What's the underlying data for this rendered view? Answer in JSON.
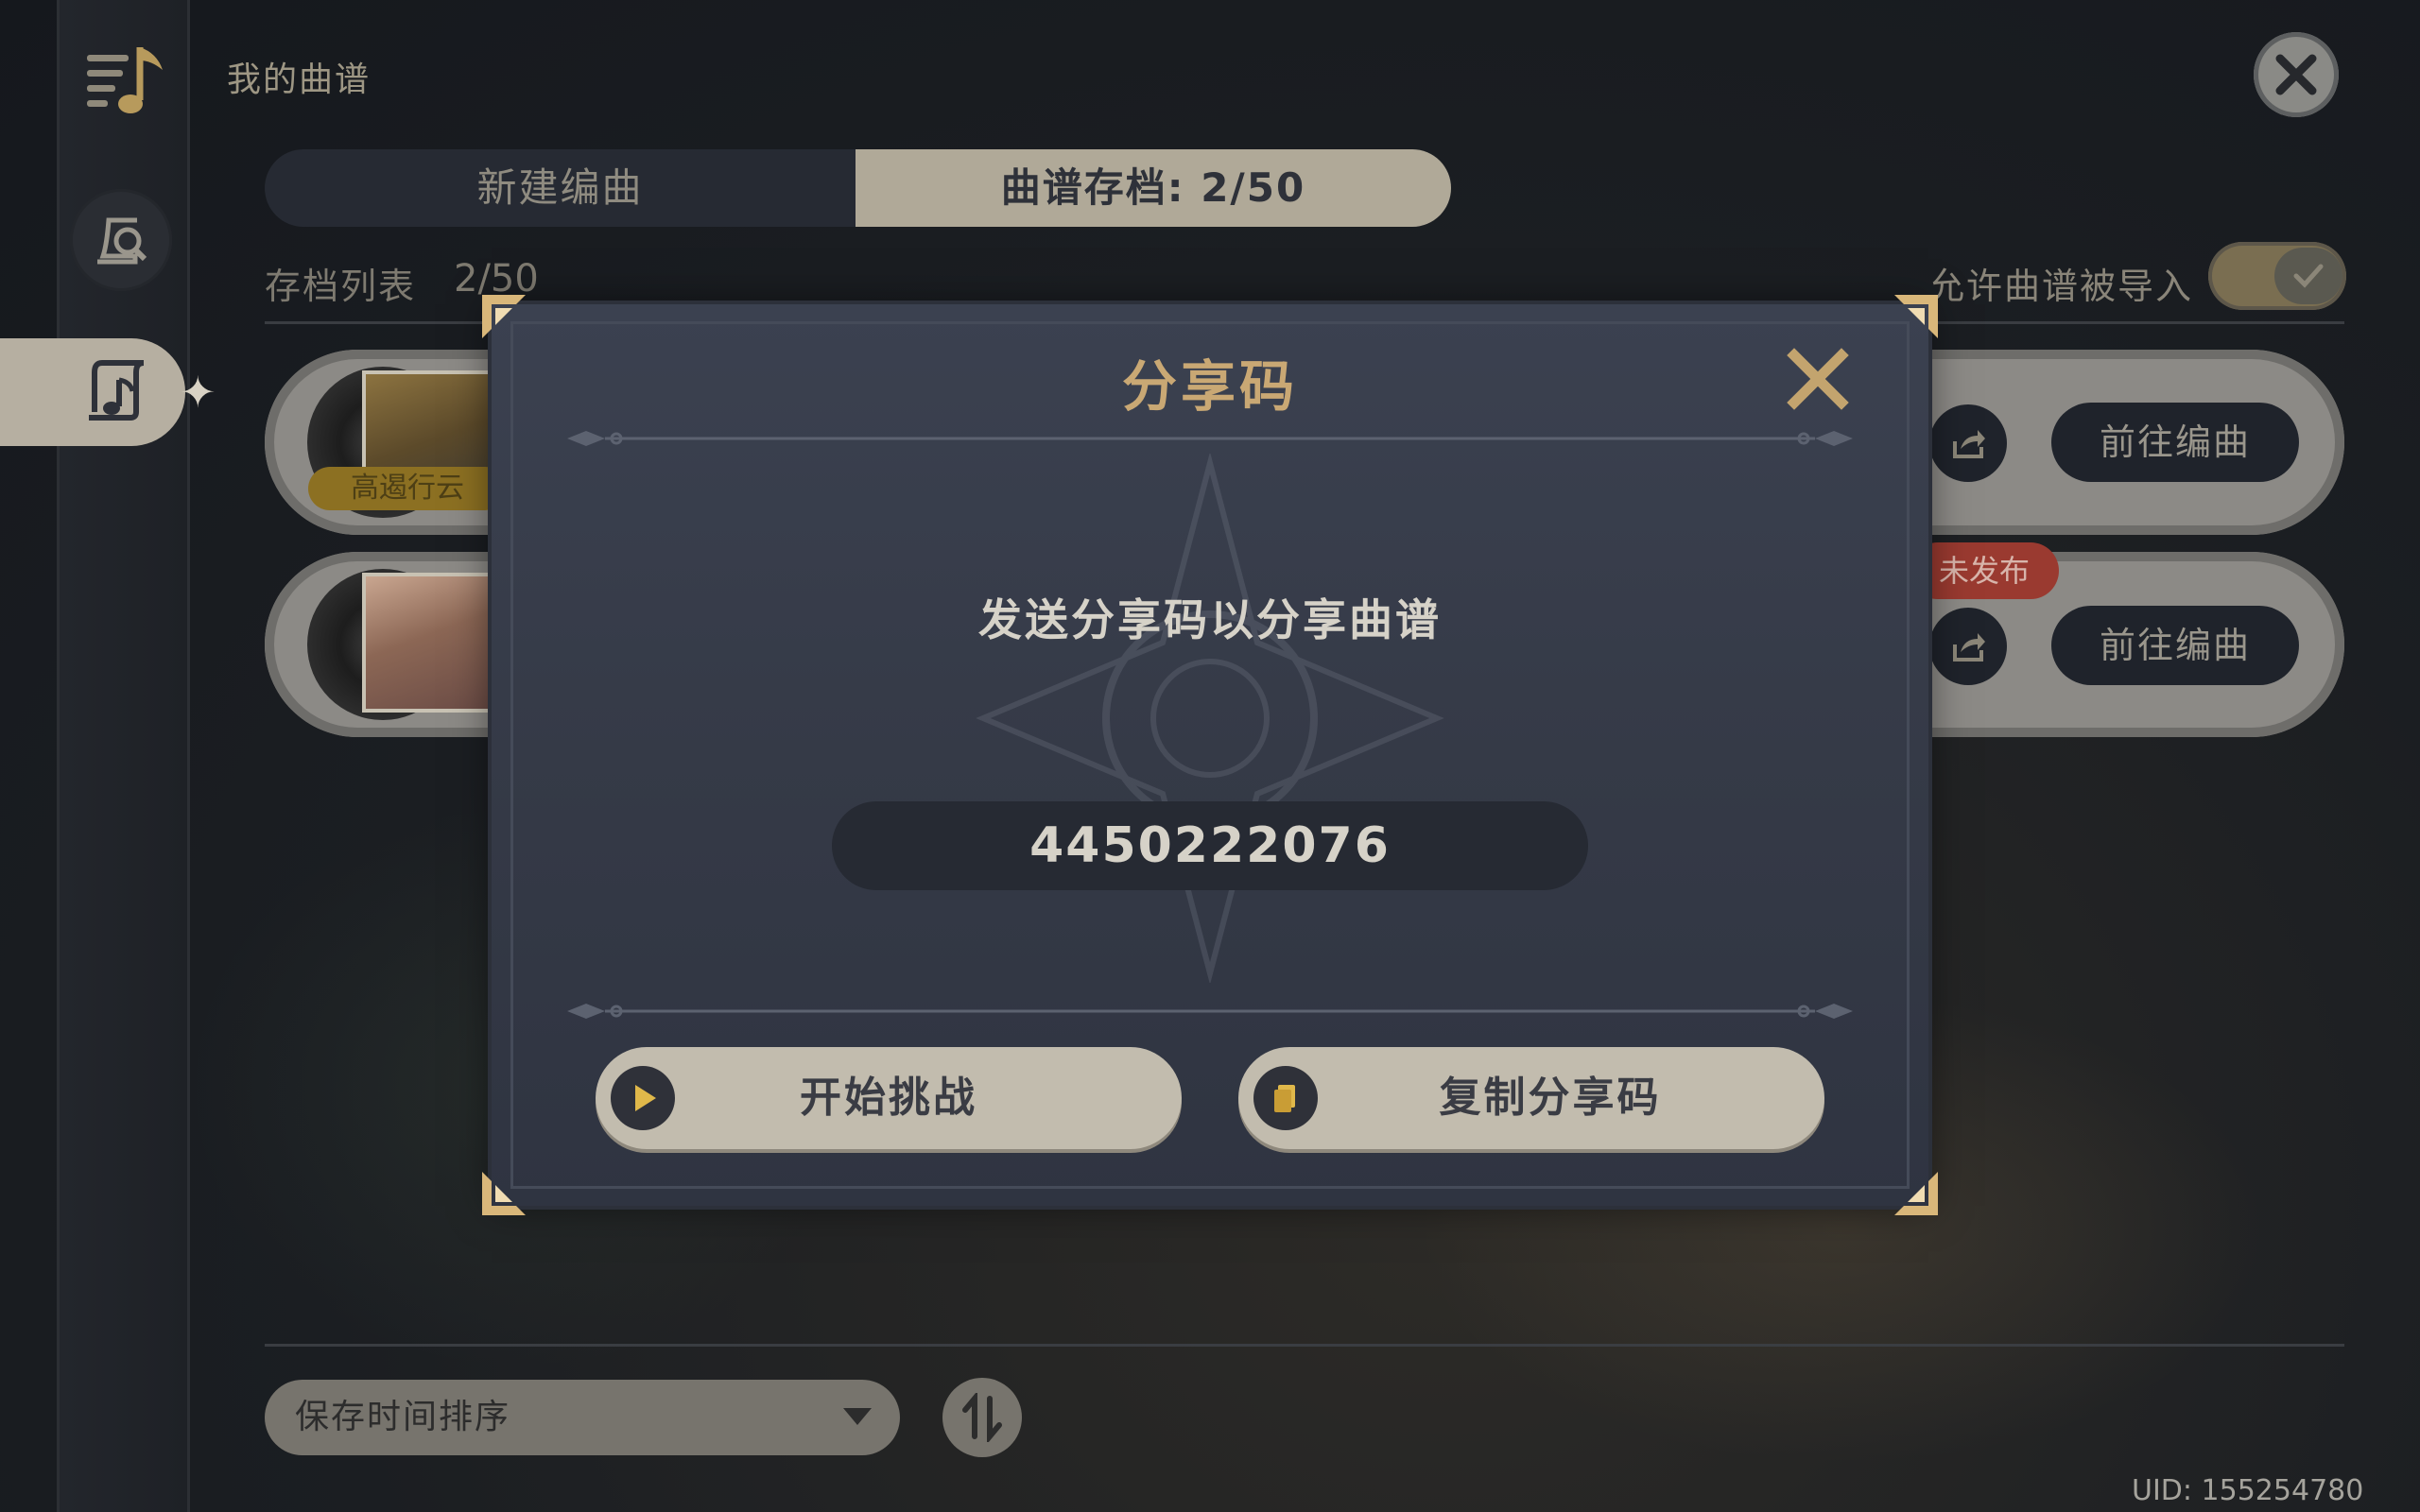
{
  "app": {
    "page_title": "我的曲谱",
    "uid": "UID: 155254780"
  },
  "tabs": [
    {
      "label": "新建编曲",
      "active": false
    },
    {
      "label": "曲谱存档: 2/50",
      "active": true
    }
  ],
  "list": {
    "label": "存档列表",
    "count": "2/50",
    "allow_import_label": "允许曲谱被导入",
    "allow_import": true
  },
  "songs": [
    {
      "tag": "高遏行云",
      "edit_label": "前往编曲",
      "status": ""
    },
    {
      "tag": "",
      "edit_label": "前往编曲",
      "status": "未发布"
    }
  ],
  "sort": {
    "selected": "保存时间排序"
  },
  "modal": {
    "title": "分享码",
    "message": "发送分享码以分享曲谱",
    "code": "4450222076",
    "buttons": {
      "challenge": "开始挑战",
      "copy": "复制分享码"
    }
  },
  "colors": {
    "accent_gold": "#c9a874",
    "modal_bg": "#353a47",
    "button_bg": "#c2bcae",
    "tag_gold": "#8c7022",
    "unpublished_red": "#9a3a30"
  },
  "icons": [
    "sheet-music-icon",
    "music-search-icon",
    "music-scroll-icon",
    "close-icon",
    "share-icon",
    "check-icon",
    "play-icon",
    "copy-icon",
    "sort-toggle-icon",
    "chevron-down-icon"
  ]
}
